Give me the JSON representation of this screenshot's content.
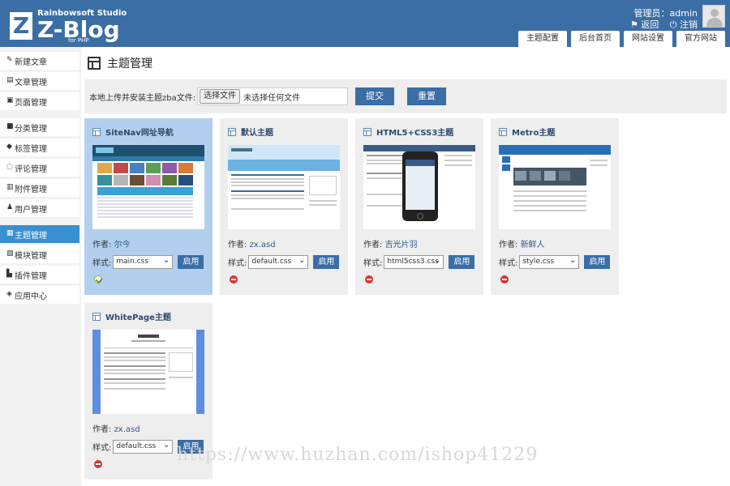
{
  "header": {
    "logo_letter": "Z",
    "studio": "Rainbowsoft Studio",
    "brand": "Z-Blog",
    "php": "for PHP",
    "user": "管理员：admin",
    "back": "返回",
    "logout": "注销",
    "tabs": [
      "主题配置",
      "后台首页",
      "网站设置",
      "官方网站"
    ]
  },
  "sidebar": {
    "items": [
      {
        "label": "新建文章",
        "icon": "edit-icon"
      },
      {
        "label": "文章管理",
        "icon": "document-icon"
      },
      {
        "label": "页面管理",
        "icon": "page-icon"
      },
      {
        "label": "分类管理",
        "icon": "folder-icon"
      },
      {
        "label": "标签管理",
        "icon": "tag-icon"
      },
      {
        "label": "评论管理",
        "icon": "comment-icon"
      },
      {
        "label": "附件管理",
        "icon": "attachment-icon"
      },
      {
        "label": "用户管理",
        "icon": "user-icon"
      },
      {
        "label": "主题管理",
        "icon": "theme-icon"
      },
      {
        "label": "模块管理",
        "icon": "module-icon"
      },
      {
        "label": "插件管理",
        "icon": "plugin-icon"
      },
      {
        "label": "应用中心",
        "icon": "app-center-icon"
      }
    ],
    "active": "主题管理"
  },
  "main": {
    "title": "主题管理",
    "upload_label": "本地上传并安装主题zba文件:",
    "file_button": "选择文件",
    "file_status": "未选择任何文件",
    "submit": "提交",
    "reset": "重置",
    "author_prefix": "作者:",
    "style_prefix": "样式:",
    "apply": "启用"
  },
  "themes": [
    {
      "name": "SiteNav网址导航",
      "author": "尔今",
      "style": "main.css",
      "active": true
    },
    {
      "name": "默认主题",
      "author": "zx.asd",
      "style": "default.css",
      "active": false
    },
    {
      "name": "HTML5+CSS3主题",
      "author": "吉光片羽",
      "style": "html5css3.css",
      "active": false
    },
    {
      "name": "Metro主题",
      "author": "新鲜人",
      "style": "style.css",
      "active": false
    },
    {
      "name": "WhitePage主题",
      "author": "zx.asd",
      "style": "default.css",
      "active": false
    }
  ],
  "watermark": "https://www.huzhan.com/ishop41229"
}
